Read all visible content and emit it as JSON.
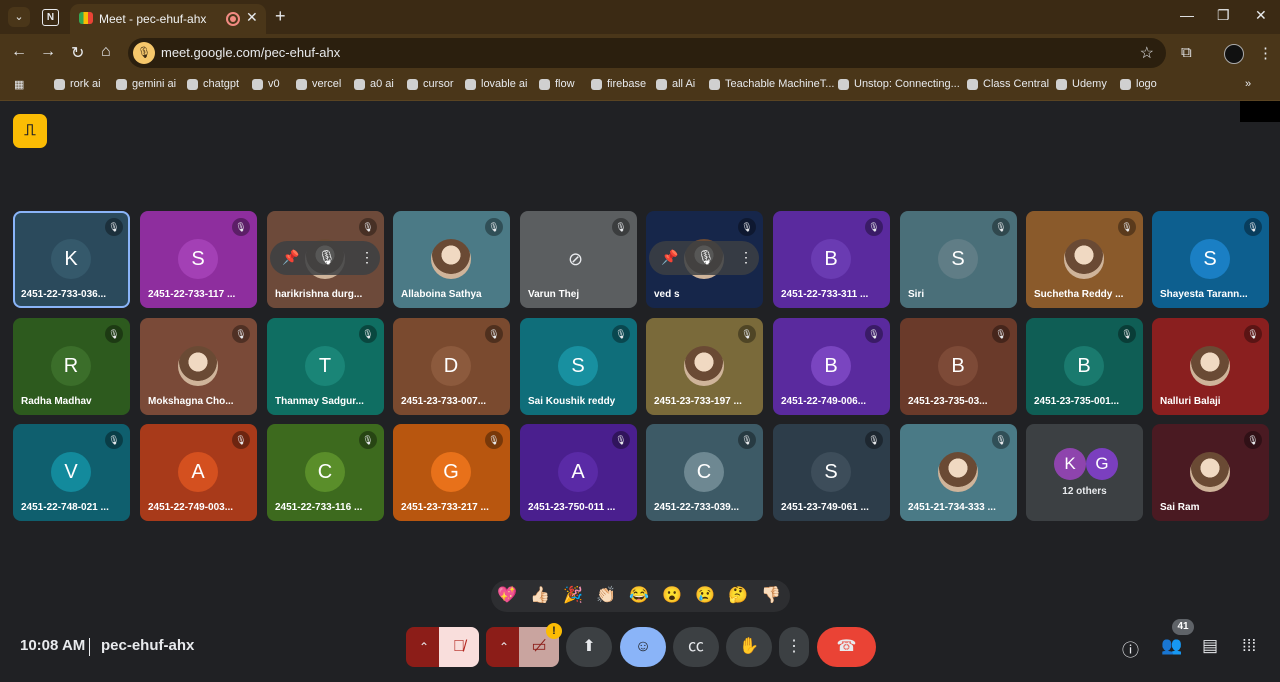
{
  "browser": {
    "tab_title": "Meet - pec-ehuf-ahx",
    "url": "meet.google.com/pec-ehuf-ahx",
    "bookmarks": [
      "rork ai",
      "gemini ai",
      "chatgpt",
      "v0",
      "vercel",
      "a0 ai",
      "cursor",
      "lovable ai",
      "flow",
      "firebase",
      "all Ai",
      "Teachable MachineT...",
      "Unstop: Connecting...",
      "Class Central",
      "Udemy",
      "logo"
    ]
  },
  "participants": [
    {
      "name": "2451-22-733-036...",
      "initial": "K",
      "bg": "#2b4a5c",
      "av": "#35596b",
      "selected": true
    },
    {
      "name": "2451-22-733-117 ...",
      "initial": "S",
      "bg": "#8e2e9e",
      "av": "#a340b5"
    },
    {
      "name": "harikrishna durg...",
      "initial": "",
      "bg": "#6d4a3a",
      "photo": true
    },
    {
      "name": "Allaboina Sathya",
      "initial": "",
      "bg": "#4b7a86",
      "photo": true
    },
    {
      "name": "Varun Thej",
      "initial": "",
      "bg": "#5b5e60",
      "camoff": true
    },
    {
      "name": "ved s",
      "initial": "",
      "bg": "#16264a",
      "photo": true
    },
    {
      "name": "2451-22-733-311 ...",
      "initial": "B",
      "bg": "#5a2a9e",
      "av": "#6a3bb2"
    },
    {
      "name": "Siri",
      "initial": "S",
      "bg": "#4a6f79",
      "av": "#607d86"
    },
    {
      "name": "Suchetha Reddy ...",
      "initial": "",
      "bg": "#8a5a2b",
      "photo": true
    },
    {
      "name": "Shayesta Tarann...",
      "initial": "S",
      "bg": "#0d5f8f",
      "av": "#1a7fc4"
    },
    {
      "name": "Radha Madhav",
      "initial": "R",
      "bg": "#2d5a1e",
      "av": "#3b6e2a"
    },
    {
      "name": "Mokshagna Cho...",
      "initial": "",
      "bg": "#7a4a38",
      "photo": true
    },
    {
      "name": "Thanmay Sadgur...",
      "initial": "T",
      "bg": "#0f6e62",
      "av": "#1a8577"
    },
    {
      "name": "2451-23-733-007...",
      "initial": "D",
      "bg": "#7a4a2f",
      "av": "#8c5a3d"
    },
    {
      "name": "Sai Koushik reddy",
      "initial": "S",
      "bg": "#0f6e7a",
      "av": "#1890a0"
    },
    {
      "name": "2451-23-733-197 ...",
      "initial": "",
      "bg": "#7a6a3a",
      "photo": true
    },
    {
      "name": "2451-22-749-006...",
      "initial": "B",
      "bg": "#5a2a9e",
      "av": "#7a45c0"
    },
    {
      "name": "2451-23-735-03...",
      "initial": "B",
      "bg": "#6a3a2a",
      "av": "#7d4a37"
    },
    {
      "name": "2451-23-735-001...",
      "initial": "B",
      "bg": "#0f5e55",
      "av": "#1a7a6e"
    },
    {
      "name": "Nalluri Balaji",
      "initial": "",
      "bg": "#8a1f1f",
      "photo": true
    },
    {
      "name": "2451-22-748-021 ...",
      "initial": "V",
      "bg": "#0f5f6e",
      "av": "#138a9c"
    },
    {
      "name": "2451-22-749-003...",
      "initial": "A",
      "bg": "#a83a1a",
      "av": "#d4501f"
    },
    {
      "name": "2451-22-733-116 ...",
      "initial": "C",
      "bg": "#3d6a1e",
      "av": "#5a8e2a"
    },
    {
      "name": "2451-23-733-217 ...",
      "initial": "G",
      "bg": "#b8560f",
      "av": "#e8711a"
    },
    {
      "name": "2451-23-750-011 ...",
      "initial": "A",
      "bg": "#4a1f8e",
      "av": "#5a2aa6"
    },
    {
      "name": "2451-22-733-039...",
      "initial": "C",
      "bg": "#3d5a66",
      "av": "#6e8892"
    },
    {
      "name": "2451-23-749-061 ...",
      "initial": "S",
      "bg": "#2d3d4a",
      "av": "#3d4d5a"
    },
    {
      "name": "2451-21-734-333 ...",
      "initial": "",
      "bg": "#4a7a86",
      "photo": true
    },
    {
      "name": "12 others",
      "initial": "",
      "bg": "#3c4043",
      "others": true,
      "mini": [
        "K",
        "G"
      ]
    },
    {
      "name": "Sai Ram",
      "initial": "",
      "bg": "#4a1a22",
      "photo": true
    }
  ],
  "reactions": [
    "💖",
    "👍🏻",
    "🎉",
    "👏🏻",
    "😂",
    "😮",
    "😢",
    "🤔",
    "👎🏻"
  ],
  "footer": {
    "time": "10:08 AM",
    "meeting_code": "pec-ehuf-ahx",
    "people_count": "41",
    "warning": "!"
  },
  "icons": {
    "mic_off": "mic-off-icon",
    "cam_off": "camera-off-icon",
    "present": "present-icon",
    "emoji": "emoji-icon",
    "captions": "captions-icon",
    "hand": "raise-hand-icon",
    "more": "more-icon",
    "leave": "hangup-icon"
  }
}
